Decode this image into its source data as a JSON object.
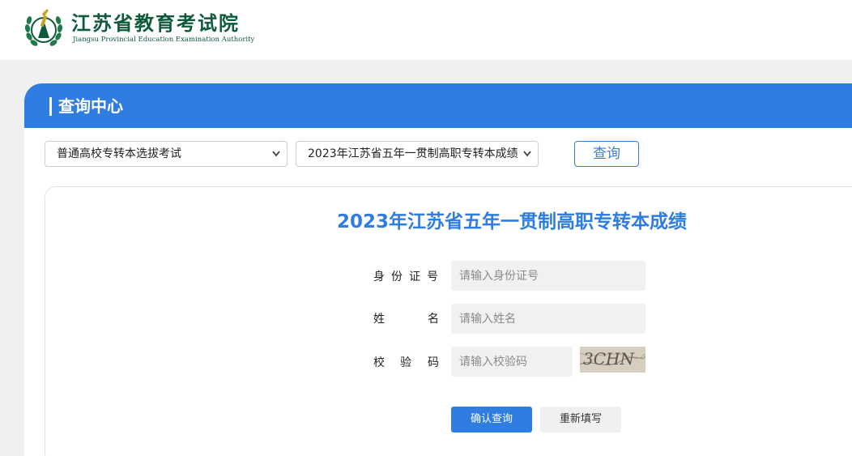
{
  "header": {
    "logo_cn": "江苏省教育考试院",
    "logo_en": "Jiangsu Provincial Education Examination Authority",
    "logo_icon": "jseea-emblem-icon"
  },
  "section": {
    "title": "查询中心"
  },
  "filters": {
    "exam_type": "普通高校专转本选拔考试",
    "exam_item": "2023年江苏省五年一贯制高职专转本成绩",
    "query_button": "查询"
  },
  "form": {
    "heading": "2023年江苏省五年一贯制高职专转本成绩",
    "id_label": "身份证号",
    "id_placeholder": "请输入身份证号",
    "name_label_1": "姓",
    "name_label_2": "名",
    "name_placeholder": "请输入姓名",
    "code_label_1": "校",
    "code_label_2": "验",
    "code_label_3": "码",
    "code_placeholder": "请输入校验码",
    "captcha_text": "3CHN",
    "confirm_button": "确认查询",
    "reset_button": "重新填写"
  },
  "colors": {
    "brand_green": "#0e5a3a",
    "accent_blue": "#2f7de1"
  }
}
